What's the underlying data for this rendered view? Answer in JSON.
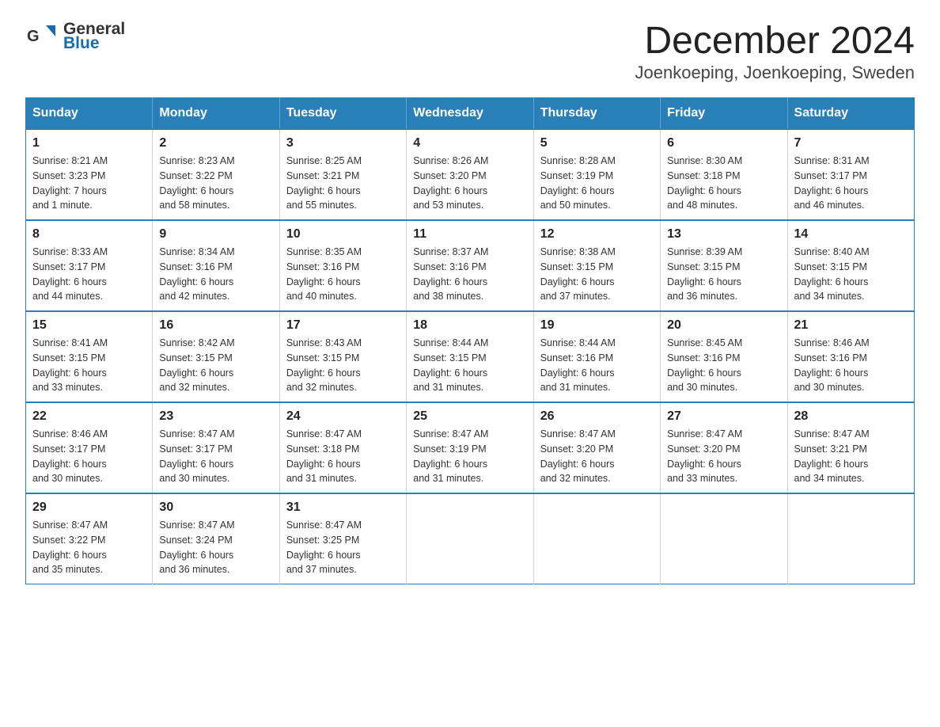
{
  "header": {
    "logo_general": "General",
    "logo_arrow": "▶",
    "logo_blue": "Blue",
    "title": "December 2024",
    "subtitle": "Joenkoeping, Joenkoeping, Sweden"
  },
  "calendar": {
    "days_of_week": [
      "Sunday",
      "Monday",
      "Tuesday",
      "Wednesday",
      "Thursday",
      "Friday",
      "Saturday"
    ],
    "weeks": [
      [
        {
          "day": "1",
          "sunrise": "Sunrise: 8:21 AM",
          "sunset": "Sunset: 3:23 PM",
          "daylight": "Daylight: 7 hours",
          "daylight2": "and 1 minute."
        },
        {
          "day": "2",
          "sunrise": "Sunrise: 8:23 AM",
          "sunset": "Sunset: 3:22 PM",
          "daylight": "Daylight: 6 hours",
          "daylight2": "and 58 minutes."
        },
        {
          "day": "3",
          "sunrise": "Sunrise: 8:25 AM",
          "sunset": "Sunset: 3:21 PM",
          "daylight": "Daylight: 6 hours",
          "daylight2": "and 55 minutes."
        },
        {
          "day": "4",
          "sunrise": "Sunrise: 8:26 AM",
          "sunset": "Sunset: 3:20 PM",
          "daylight": "Daylight: 6 hours",
          "daylight2": "and 53 minutes."
        },
        {
          "day": "5",
          "sunrise": "Sunrise: 8:28 AM",
          "sunset": "Sunset: 3:19 PM",
          "daylight": "Daylight: 6 hours",
          "daylight2": "and 50 minutes."
        },
        {
          "day": "6",
          "sunrise": "Sunrise: 8:30 AM",
          "sunset": "Sunset: 3:18 PM",
          "daylight": "Daylight: 6 hours",
          "daylight2": "and 48 minutes."
        },
        {
          "day": "7",
          "sunrise": "Sunrise: 8:31 AM",
          "sunset": "Sunset: 3:17 PM",
          "daylight": "Daylight: 6 hours",
          "daylight2": "and 46 minutes."
        }
      ],
      [
        {
          "day": "8",
          "sunrise": "Sunrise: 8:33 AM",
          "sunset": "Sunset: 3:17 PM",
          "daylight": "Daylight: 6 hours",
          "daylight2": "and 44 minutes."
        },
        {
          "day": "9",
          "sunrise": "Sunrise: 8:34 AM",
          "sunset": "Sunset: 3:16 PM",
          "daylight": "Daylight: 6 hours",
          "daylight2": "and 42 minutes."
        },
        {
          "day": "10",
          "sunrise": "Sunrise: 8:35 AM",
          "sunset": "Sunset: 3:16 PM",
          "daylight": "Daylight: 6 hours",
          "daylight2": "and 40 minutes."
        },
        {
          "day": "11",
          "sunrise": "Sunrise: 8:37 AM",
          "sunset": "Sunset: 3:16 PM",
          "daylight": "Daylight: 6 hours",
          "daylight2": "and 38 minutes."
        },
        {
          "day": "12",
          "sunrise": "Sunrise: 8:38 AM",
          "sunset": "Sunset: 3:15 PM",
          "daylight": "Daylight: 6 hours",
          "daylight2": "and 37 minutes."
        },
        {
          "day": "13",
          "sunrise": "Sunrise: 8:39 AM",
          "sunset": "Sunset: 3:15 PM",
          "daylight": "Daylight: 6 hours",
          "daylight2": "and 36 minutes."
        },
        {
          "day": "14",
          "sunrise": "Sunrise: 8:40 AM",
          "sunset": "Sunset: 3:15 PM",
          "daylight": "Daylight: 6 hours",
          "daylight2": "and 34 minutes."
        }
      ],
      [
        {
          "day": "15",
          "sunrise": "Sunrise: 8:41 AM",
          "sunset": "Sunset: 3:15 PM",
          "daylight": "Daylight: 6 hours",
          "daylight2": "and 33 minutes."
        },
        {
          "day": "16",
          "sunrise": "Sunrise: 8:42 AM",
          "sunset": "Sunset: 3:15 PM",
          "daylight": "Daylight: 6 hours",
          "daylight2": "and 32 minutes."
        },
        {
          "day": "17",
          "sunrise": "Sunrise: 8:43 AM",
          "sunset": "Sunset: 3:15 PM",
          "daylight": "Daylight: 6 hours",
          "daylight2": "and 32 minutes."
        },
        {
          "day": "18",
          "sunrise": "Sunrise: 8:44 AM",
          "sunset": "Sunset: 3:15 PM",
          "daylight": "Daylight: 6 hours",
          "daylight2": "and 31 minutes."
        },
        {
          "day": "19",
          "sunrise": "Sunrise: 8:44 AM",
          "sunset": "Sunset: 3:16 PM",
          "daylight": "Daylight: 6 hours",
          "daylight2": "and 31 minutes."
        },
        {
          "day": "20",
          "sunrise": "Sunrise: 8:45 AM",
          "sunset": "Sunset: 3:16 PM",
          "daylight": "Daylight: 6 hours",
          "daylight2": "and 30 minutes."
        },
        {
          "day": "21",
          "sunrise": "Sunrise: 8:46 AM",
          "sunset": "Sunset: 3:16 PM",
          "daylight": "Daylight: 6 hours",
          "daylight2": "and 30 minutes."
        }
      ],
      [
        {
          "day": "22",
          "sunrise": "Sunrise: 8:46 AM",
          "sunset": "Sunset: 3:17 PM",
          "daylight": "Daylight: 6 hours",
          "daylight2": "and 30 minutes."
        },
        {
          "day": "23",
          "sunrise": "Sunrise: 8:47 AM",
          "sunset": "Sunset: 3:17 PM",
          "daylight": "Daylight: 6 hours",
          "daylight2": "and 30 minutes."
        },
        {
          "day": "24",
          "sunrise": "Sunrise: 8:47 AM",
          "sunset": "Sunset: 3:18 PM",
          "daylight": "Daylight: 6 hours",
          "daylight2": "and 31 minutes."
        },
        {
          "day": "25",
          "sunrise": "Sunrise: 8:47 AM",
          "sunset": "Sunset: 3:19 PM",
          "daylight": "Daylight: 6 hours",
          "daylight2": "and 31 minutes."
        },
        {
          "day": "26",
          "sunrise": "Sunrise: 8:47 AM",
          "sunset": "Sunset: 3:20 PM",
          "daylight": "Daylight: 6 hours",
          "daylight2": "and 32 minutes."
        },
        {
          "day": "27",
          "sunrise": "Sunrise: 8:47 AM",
          "sunset": "Sunset: 3:20 PM",
          "daylight": "Daylight: 6 hours",
          "daylight2": "and 33 minutes."
        },
        {
          "day": "28",
          "sunrise": "Sunrise: 8:47 AM",
          "sunset": "Sunset: 3:21 PM",
          "daylight": "Daylight: 6 hours",
          "daylight2": "and 34 minutes."
        }
      ],
      [
        {
          "day": "29",
          "sunrise": "Sunrise: 8:47 AM",
          "sunset": "Sunset: 3:22 PM",
          "daylight": "Daylight: 6 hours",
          "daylight2": "and 35 minutes."
        },
        {
          "day": "30",
          "sunrise": "Sunrise: 8:47 AM",
          "sunset": "Sunset: 3:24 PM",
          "daylight": "Daylight: 6 hours",
          "daylight2": "and 36 minutes."
        },
        {
          "day": "31",
          "sunrise": "Sunrise: 8:47 AM",
          "sunset": "Sunset: 3:25 PM",
          "daylight": "Daylight: 6 hours",
          "daylight2": "and 37 minutes."
        },
        null,
        null,
        null,
        null
      ]
    ]
  }
}
